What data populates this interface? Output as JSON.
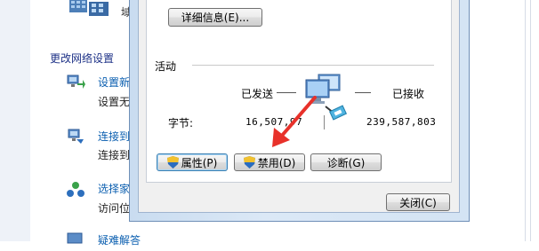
{
  "background": {
    "top_text": "域",
    "section_title": "更改网络设置",
    "tasks": [
      {
        "link": "设置新",
        "desc": "设置无"
      },
      {
        "link": "连接到",
        "desc": "连接到"
      },
      {
        "link": "选择家",
        "desc": "访问位"
      },
      {
        "link": "疑难解答",
        "desc": ""
      }
    ]
  },
  "dialog": {
    "details_button": "详细信息(E)...",
    "activity_label": "活动",
    "sent_label": "已发送",
    "received_label": "已接收",
    "bytes_label": "字节:",
    "bytes_sent": "16,507,97",
    "bytes_received": "239,587,803",
    "properties_button": "属性(P)",
    "disable_button": "禁用(D)",
    "diagnose_button": "诊断(G)",
    "close_button": "关闭(C)"
  },
  "colors": {
    "link": "#0b5fb0",
    "section_title": "#1e3287",
    "annotation_arrow": "#e8312a"
  }
}
